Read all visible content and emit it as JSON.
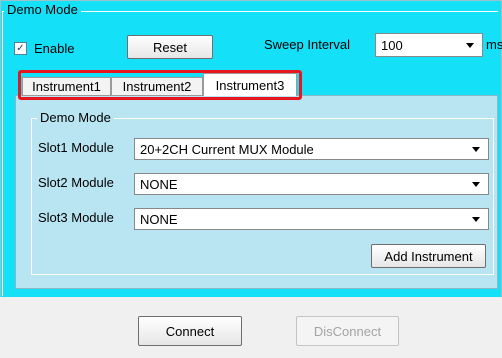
{
  "demo_mode": {
    "legend": "Demo Mode",
    "enable_label": "Enable",
    "enable_checked": true,
    "checkmark": "✓",
    "reset_label": "Reset",
    "sweep_interval_label": "Sweep Interval",
    "sweep_interval_value": "100",
    "unit_label": "ms"
  },
  "tabs": [
    {
      "label": "Instrument1",
      "active": false
    },
    {
      "label": "Instrument2",
      "active": false
    },
    {
      "label": "Instrument3",
      "active": true
    }
  ],
  "instrument_panel": {
    "legend": "Demo Mode",
    "slots": [
      {
        "label": "Slot1 Module",
        "value": "20+2CH Current MUX Module"
      },
      {
        "label": "Slot2 Module",
        "value": "NONE"
      },
      {
        "label": "Slot3 Module",
        "value": "NONE"
      }
    ],
    "add_instrument_label": "Add Instrument"
  },
  "footer": {
    "connect_label": "Connect",
    "disconnect_label": "DisConnect",
    "disconnect_enabled": false
  },
  "colors": {
    "outer_background": "#14e0f8",
    "panel_background": "#b9e5f2",
    "highlight_border": "#e8161e"
  }
}
